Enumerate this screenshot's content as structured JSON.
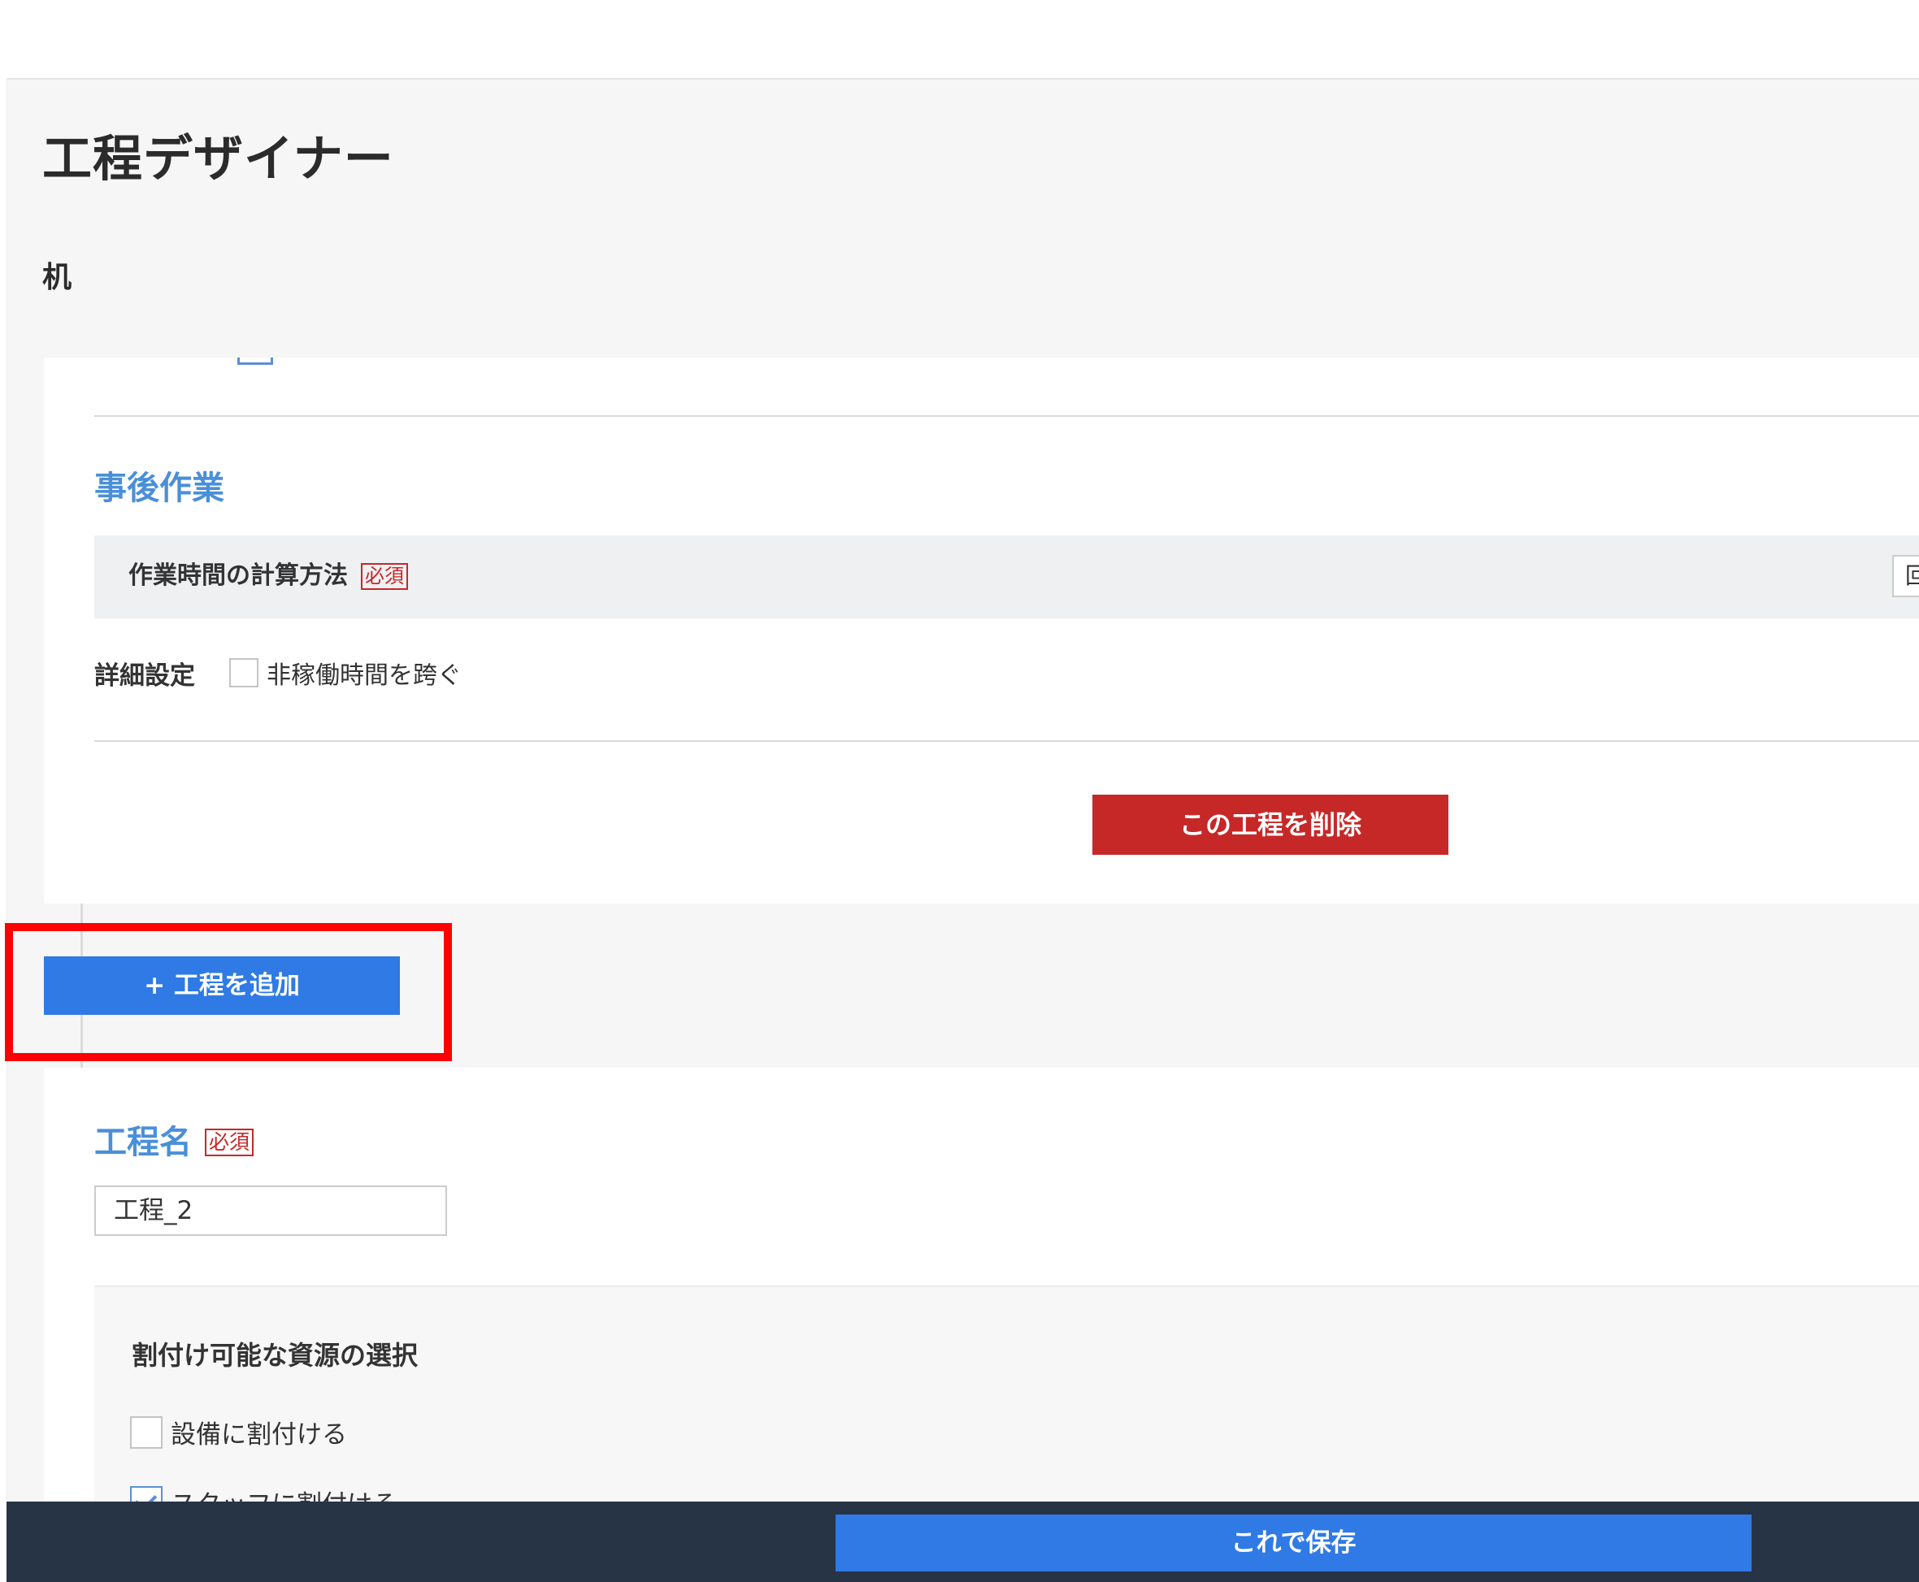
{
  "page": {
    "title": "工程デザイナー",
    "product_name": "机"
  },
  "post_work": {
    "section_title": "事後作業",
    "calc_method_label": "作業時間の計算方法",
    "required_badge": "必須",
    "select_value_partial": "回",
    "detail_settings_label": "詳細設定",
    "cross_non_working_label": "非稼働時間を跨ぐ",
    "cross_non_working_checked": false
  },
  "actions": {
    "delete_label": "この工程を削除",
    "add_label": "+ 工程を追加",
    "save_label": "これで保存"
  },
  "process2": {
    "name_label": "工程名",
    "required_badge": "必須",
    "name_value": "工程_2",
    "resource_title": "割付け可能な資源の選択",
    "options": [
      {
        "label": "設備に割付ける",
        "checked": false
      },
      {
        "label": "スタッフに割付ける",
        "checked": true
      }
    ]
  },
  "colors": {
    "accent_blue": "#2f7ae5",
    "section_title_blue": "#4a8fd8",
    "danger_red": "#c62828",
    "highlight_red": "#ff0000",
    "footer_navy": "#263445"
  }
}
